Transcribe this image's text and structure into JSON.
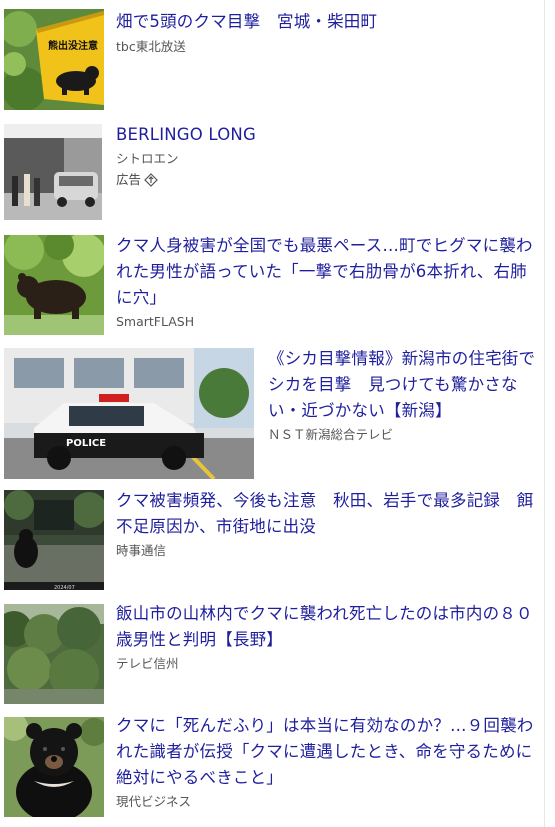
{
  "articles": [
    {
      "title": "畑で5頭のクマ目撃　宮城・柴田町",
      "source": "tbc東北放送",
      "thumbnail": "bear-warning-sign-icon"
    },
    {
      "title": "BERLINGO LONG",
      "source": "シトロエン",
      "ad_label": "広告",
      "thumbnail": "car-showroom-icon"
    },
    {
      "title": "クマ人身被害が全国でも最悪ペース…町でヒグマに襲われた男性が語っていた「一撃で右肋骨が6本折れ、右肺に穴」",
      "source": "SmartFLASH",
      "thumbnail": "brown-bear-icon"
    },
    {
      "title": "《シカ目撃情報》新潟市の住宅街でシカを目撃　見つけても驚かさない・近づかない【新潟】",
      "source": "ＮＳＴ新潟総合テレビ",
      "thumbnail": "police-car-icon"
    },
    {
      "title": "クマ被害頻発、今後も注意　秋田、岩手で最多記録　餌不足原因か、市街地に出没",
      "source": "時事通信",
      "thumbnail": "trail-camera-bear-icon"
    },
    {
      "title": "飯山市の山林内でクマに襲われ死亡したのは市内の８０歳男性と判明【長野】",
      "source": "テレビ信州",
      "thumbnail": "forest-icon"
    },
    {
      "title": "クマに「死んだふり」は本当に有効なのか？…９回襲われた識者が伝授「クマに遭遇したとき、命を守るために絶対にやるべきこと」",
      "source": "現代ビジネス",
      "thumbnail": "black-bear-icon"
    }
  ]
}
